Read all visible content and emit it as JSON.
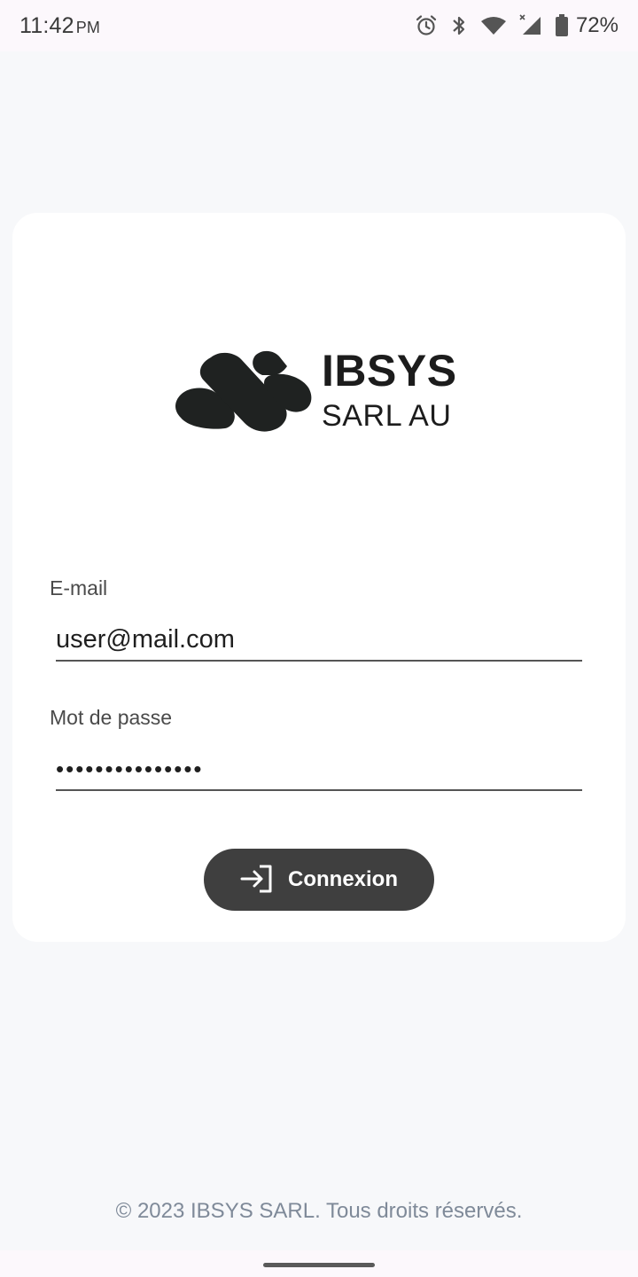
{
  "status_bar": {
    "time": "11:42",
    "ampm": "PM",
    "battery": "72%",
    "icons": [
      "alarm-icon",
      "bluetooth-icon",
      "wifi-icon",
      "signal-icon",
      "battery-icon"
    ]
  },
  "logo": {
    "title": "IBSYS",
    "subtitle": "SARL AU"
  },
  "form": {
    "email_label": "E-mail",
    "email_value": "user@mail.com",
    "password_label": "Mot de passe",
    "password_value": "•••••••••••••••",
    "submit_label": "Connexion",
    "submit_icon": "login-icon"
  },
  "footer": {
    "text": "© 2023 IBSYS SARL. Tous droits réservés."
  },
  "colors": {
    "background": "#f7f8fa",
    "card": "#ffffff",
    "button": "#3f3f3f",
    "footer_text": "#7f8a99"
  }
}
